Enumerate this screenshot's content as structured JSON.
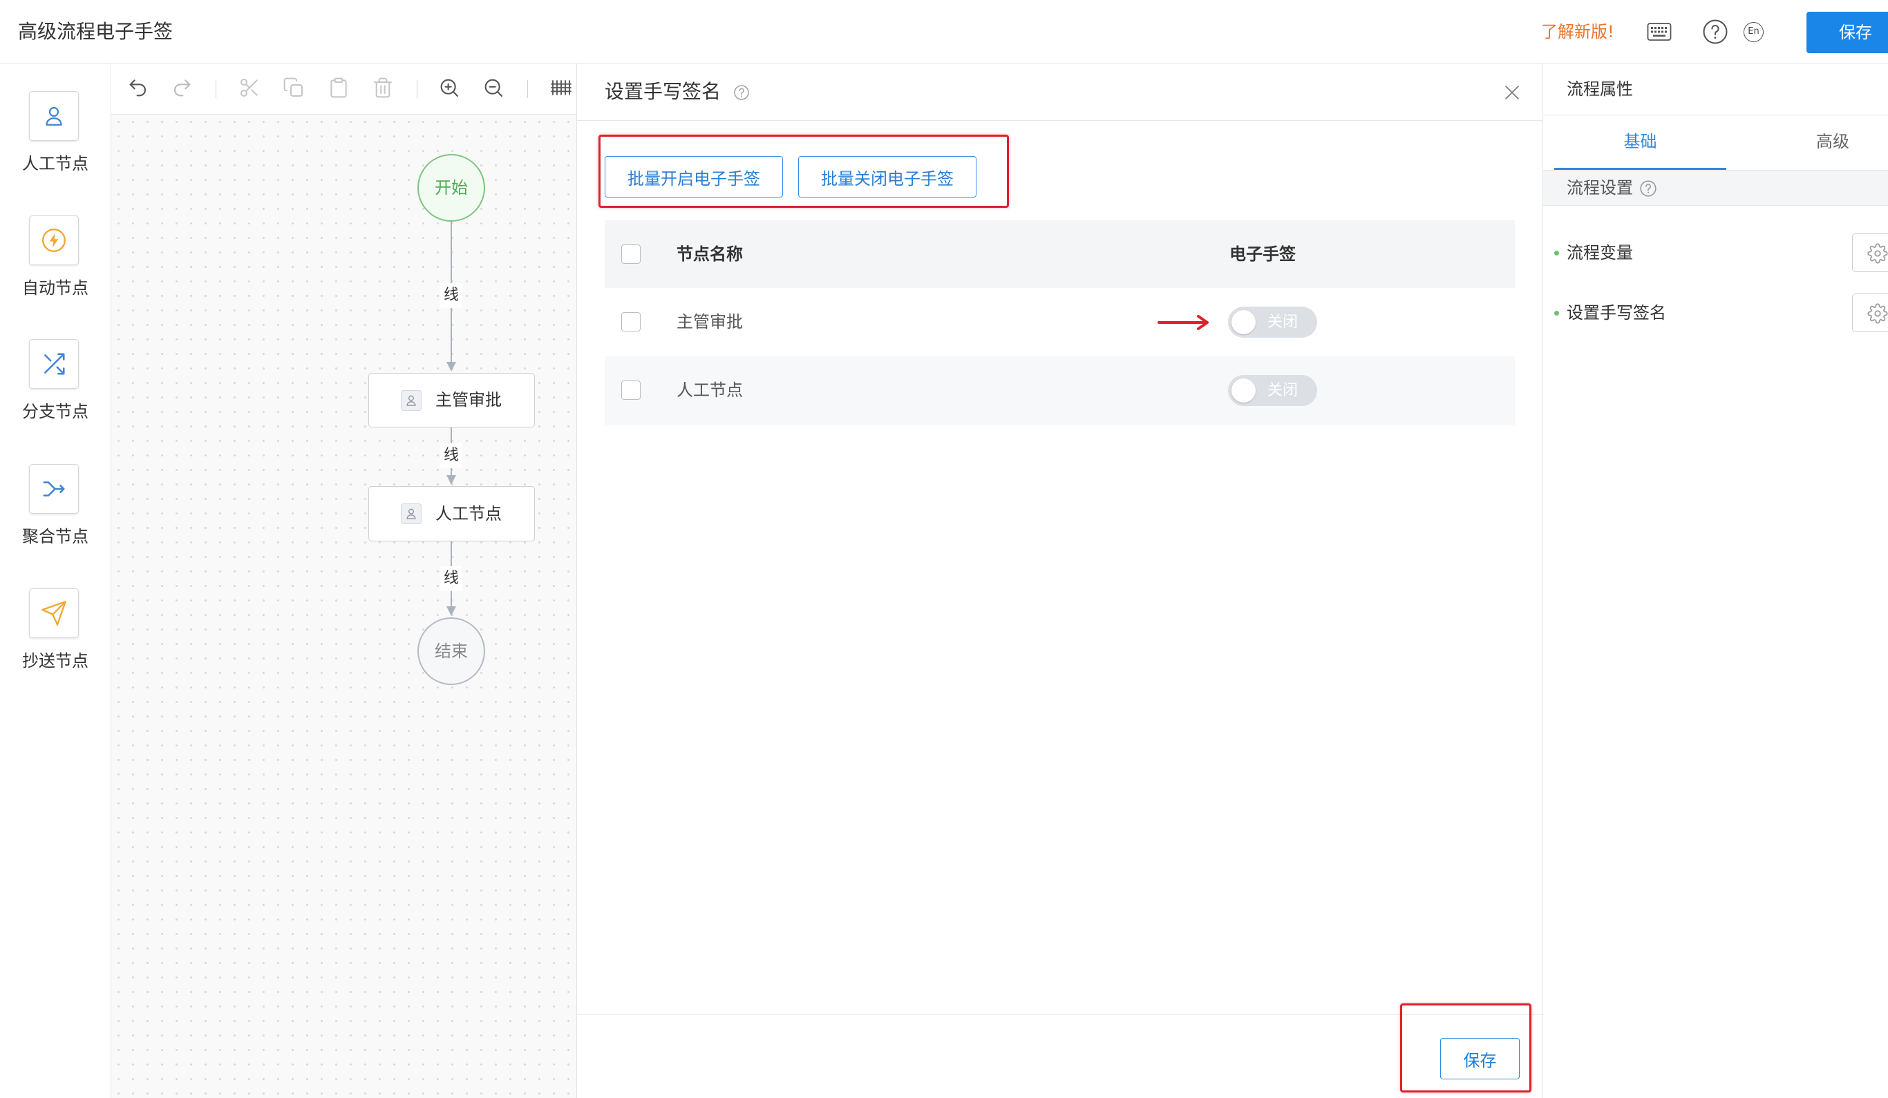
{
  "header": {
    "title": "高级流程电子手签",
    "whats_new": "了解新版!",
    "lang": "En",
    "save_label": "保存",
    "icons": [
      "keyboard-icon",
      "help-circle-icon"
    ]
  },
  "sidebar": {
    "items": [
      {
        "label": "人工节点",
        "icon": "user-icon"
      },
      {
        "label": "自动节点",
        "icon": "lightning-icon"
      },
      {
        "label": "分支节点",
        "icon": "branch-icon"
      },
      {
        "label": "聚合节点",
        "icon": "merge-icon"
      },
      {
        "label": "抄送节点",
        "icon": "send-icon"
      }
    ]
  },
  "toolbar": {
    "tools": [
      {
        "icon": "undo-icon",
        "enabled": true
      },
      {
        "icon": "redo-icon",
        "enabled": false
      },
      {
        "icon": "cut-icon",
        "enabled": false
      },
      {
        "icon": "copy-icon",
        "enabled": false
      },
      {
        "icon": "paste-icon",
        "enabled": false
      },
      {
        "icon": "delete-icon",
        "enabled": false
      },
      {
        "icon": "zoom-in-icon",
        "enabled": true
      },
      {
        "icon": "zoom-out-icon",
        "enabled": true
      },
      {
        "icon": "grid-icon",
        "enabled": true
      }
    ]
  },
  "flow": {
    "start": "开始",
    "end": "结束",
    "lines": [
      "线",
      "线",
      "线"
    ],
    "nodes": [
      "主管审批",
      "人工节点"
    ]
  },
  "dialog": {
    "title": "设置手写签名",
    "batch_enable_label": "批量开启电子手签",
    "batch_disable_label": "批量关闭电子手签",
    "columns": {
      "name": "节点名称",
      "signature": "电子手签"
    },
    "rows": [
      {
        "name": "主管审批",
        "signature_status": "关闭",
        "enabled": false,
        "checked": false
      },
      {
        "name": "人工节点",
        "signature_status": "关闭",
        "enabled": false,
        "checked": false
      }
    ],
    "save_label": "保存"
  },
  "properties": {
    "title": "流程属性",
    "tabs": [
      {
        "label": "基础",
        "active": true
      },
      {
        "label": "高级",
        "active": false
      }
    ],
    "section_title": "流程设置",
    "items": [
      "流程变量",
      "设置手写签名"
    ]
  },
  "colors": {
    "accent": "#1a86e8",
    "link_orange": "#e8742a",
    "start_green": "#4fa955",
    "annotation_red": "#e0202a",
    "toggle_off": "#dcdfe4"
  }
}
